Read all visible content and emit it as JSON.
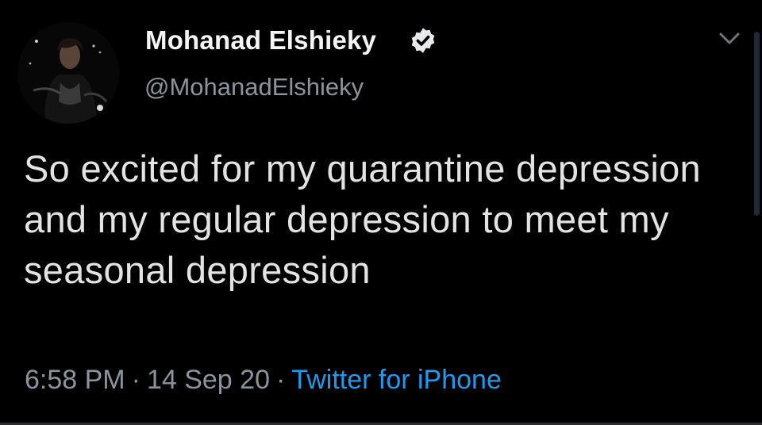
{
  "tweet": {
    "author": {
      "display_name": "Mohanad Elshieky",
      "handle": "@MohanadElshieky",
      "verified": true
    },
    "text": "So excited for my quarantine depression and my regular depression to meet my seasonal depression",
    "time": "6:58 PM",
    "separator": "·",
    "date": "14 Sep 20",
    "source": "Twitter for iPhone"
  },
  "icons": {
    "verified": "verified-badge-icon",
    "menu": "chevron-down-icon"
  },
  "colors": {
    "background": "#000000",
    "name": "#f5f5f5",
    "secondary": "#8b949e",
    "link": "#1d9bf0",
    "body": "#e3e3e3"
  }
}
